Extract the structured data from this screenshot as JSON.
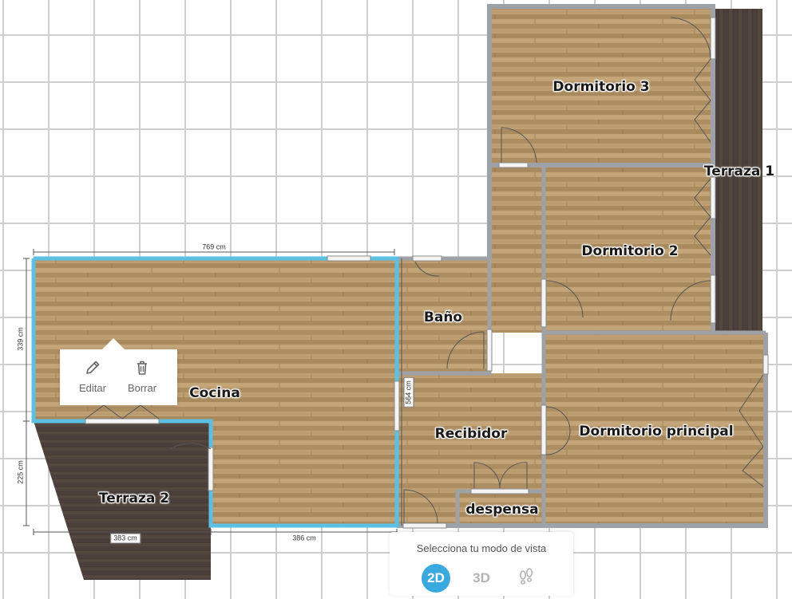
{
  "rooms": {
    "dormitorio3": "Dormitorio 3",
    "terraza1": "Terraza 1",
    "dormitorio2": "Dormitorio 2",
    "bano": "Baño",
    "cocina": "Cocina",
    "recibidor": "Recibidor",
    "dormitorio_principal": "Dormitorio principal",
    "terraza2": "Terraza 2",
    "despensa": "despensa"
  },
  "dimensions": {
    "top_width": "769 cm",
    "left_height": "339 cm",
    "mid_height": "564 cm",
    "terrace_height": "225 cm",
    "terrace_width": "383 cm",
    "bottom_width": "386 cm"
  },
  "context_menu": {
    "edit_label": "Editar",
    "delete_label": "Borrar"
  },
  "view_panel": {
    "title": "Selecciona tu modo de vista",
    "mode_2d": "2D",
    "mode_3d": "3D",
    "active_mode": "2D"
  },
  "colors": {
    "selection": "#5bc0e3",
    "accent": "#3aa9dd",
    "wall": "#9ea2a6",
    "floor_wood": "#b99a6d",
    "deck": "#4a3f3b"
  },
  "icons": {
    "edit": "pencil-icon",
    "delete": "trash-icon",
    "walk": "footprints-icon"
  }
}
